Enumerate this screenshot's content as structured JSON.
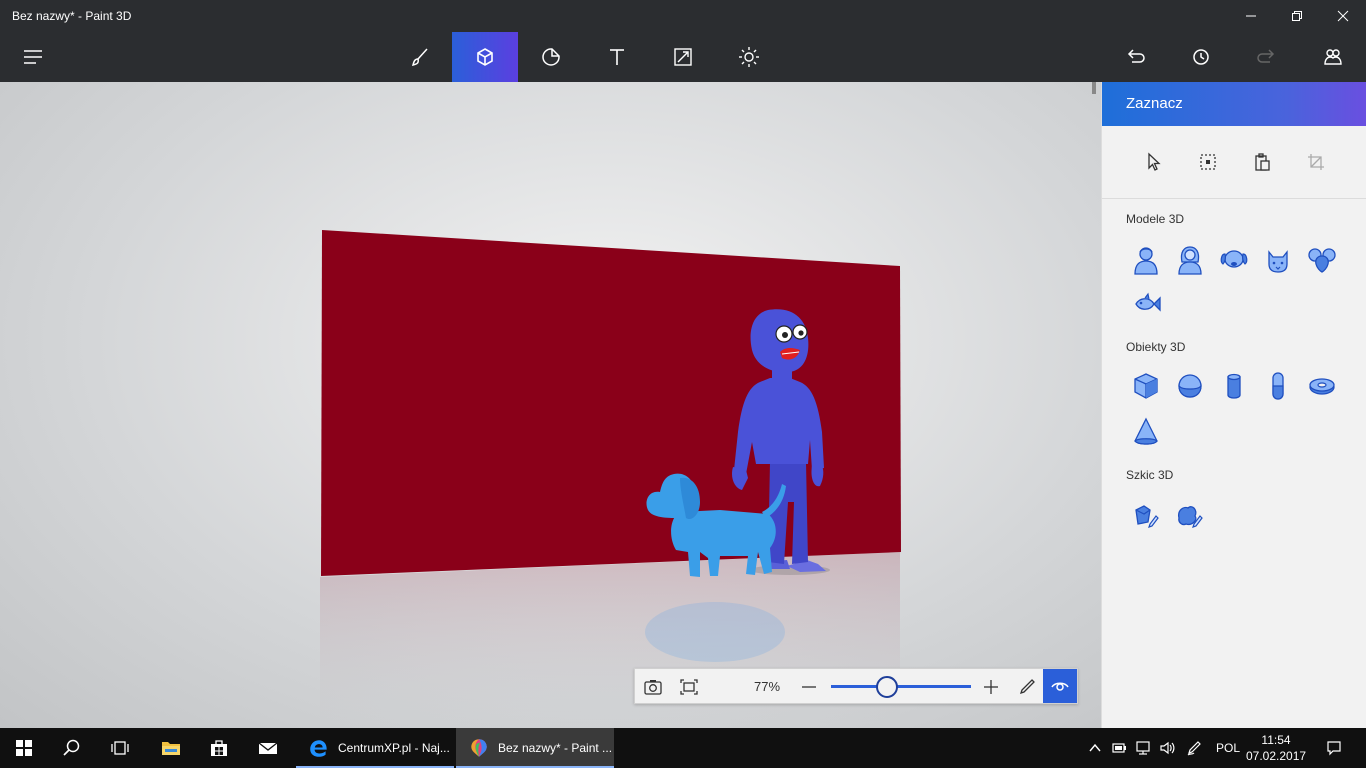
{
  "window": {
    "title": "Bez nazwy* - Paint 3D"
  },
  "toolbar": {
    "tools": [
      {
        "name": "brushes-tool",
        "icon": "brush-icon"
      },
      {
        "name": "3d-objects-tool",
        "icon": "cube-icon",
        "active": true
      },
      {
        "name": "stickers-tool",
        "icon": "sticker-icon"
      },
      {
        "name": "text-tool",
        "icon": "text-icon"
      },
      {
        "name": "canvas-tool",
        "icon": "resize-icon"
      },
      {
        "name": "effects-tool",
        "icon": "sun-icon"
      }
    ],
    "accent": "#2b5fd9"
  },
  "canvas": {
    "wall_color": "#8a0019",
    "figure_color": "#4a52d8",
    "dog_color": "#3a9ee8"
  },
  "zoom": {
    "percent_label": "77%",
    "level": 0.4
  },
  "panel": {
    "title": "Zaznacz",
    "sections": {
      "models": "Modele 3D",
      "objects": "Obiekty 3D",
      "sketch": "Szkic 3D"
    }
  },
  "taskbar": {
    "apps": [
      {
        "label": "CentrumXP.pl - Naj..."
      },
      {
        "label": "Bez nazwy* - Paint ..."
      }
    ],
    "language": "POL",
    "time": "11:54",
    "date": "07.02.2017"
  }
}
